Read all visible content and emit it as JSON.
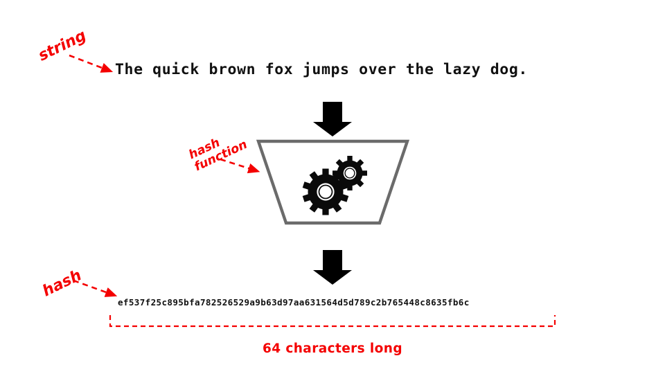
{
  "diagram": {
    "title_concept": "hash-function-diagram",
    "input": {
      "label": "string",
      "value": "The quick brown fox jumps over the lazy dog."
    },
    "process": {
      "label_line1": "hash",
      "label_line2": "function",
      "icon": "gears-icon",
      "shape": "funnel-trapezoid"
    },
    "output": {
      "label": "hash",
      "value": "ef537f25c895bfa782526529a9b63d97aa631564d5d789c2b765448c8635fb6c",
      "caption": "64 characters long"
    },
    "arrows": {
      "top_arrow": "down-arrow-icon",
      "bottom_arrow": "down-arrow-icon"
    },
    "colors": {
      "annotation_red": "#f40000",
      "funnel_stroke": "#6b6b6b",
      "arrow_black": "#000000",
      "text_black": "#101010",
      "background": "#ffffff"
    }
  }
}
